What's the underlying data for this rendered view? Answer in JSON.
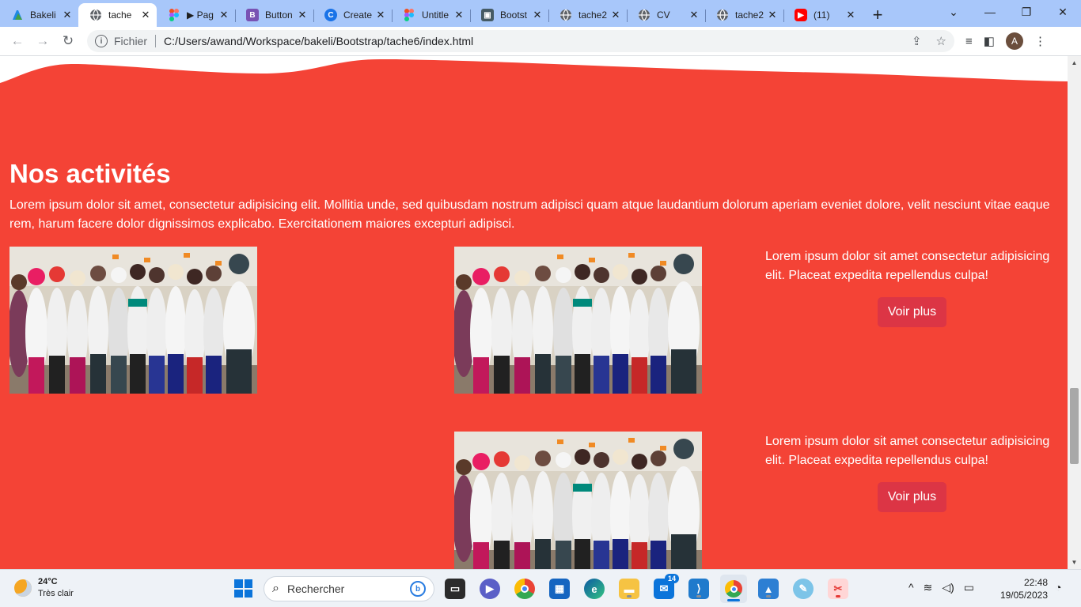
{
  "browser": {
    "tabs": [
      {
        "title": "Bakeli",
        "icon": "bakeli-icon",
        "color": "#4caf50",
        "active": false
      },
      {
        "title": "tache",
        "icon": "globe-icon",
        "color": "#5f6368",
        "active": true
      },
      {
        "title": "▶ Pag",
        "icon": "figma-icon",
        "color": "#f24e1e",
        "active": false
      },
      {
        "title": "Button",
        "icon": "bootstrap-icon",
        "color": "#7952b3",
        "active": false
      },
      {
        "title": "Create",
        "icon": "canva-icon",
        "color": "#1a73e8",
        "active": false
      },
      {
        "title": "Untitle",
        "icon": "figma-icon",
        "color": "#f24e1e",
        "active": false
      },
      {
        "title": "Bootst",
        "icon": "bootstrap-site-icon",
        "color": "#455a64",
        "active": false
      },
      {
        "title": "tache2",
        "icon": "globe-icon",
        "color": "#5f6368",
        "active": false
      },
      {
        "title": "CV",
        "icon": "globe-icon",
        "color": "#5f6368",
        "active": false
      },
      {
        "title": "tache2",
        "icon": "globe-icon",
        "color": "#5f6368",
        "active": false
      },
      {
        "title": "(11)",
        "icon": "youtube-icon",
        "color": "#ff0000",
        "active": false
      }
    ],
    "address": {
      "scheme_label": "Fichier",
      "url": "C:/Users/awand/Workspace/bakeli/Bootstrap/tache6/index.html"
    },
    "profile_initial": "A"
  },
  "page": {
    "section_title": "Nos activités",
    "intro": "Lorem ipsum dolor sit amet, consectetur adipisicing elit. Mollitia unde, sed quibusdam nostrum adipisci quam atque laudantium dolorum aperiam eveniet dolore, velit nesciunt vitae eaque rem, harum facere dolor dignissimos explicabo. Exercitationem maiores excepturi adipisci.",
    "cards": [
      {
        "text": "Lorem ipsum dolor sit amet consectetur adipisicing elit. Placeat expedita repellendus culpa!",
        "button": "Voir plus"
      },
      {
        "text": "Lorem ipsum dolor sit amet consectetur adipisicing elit. Placeat expedita repellendus culpa!",
        "button": "Voir plus"
      }
    ],
    "colors": {
      "background": "#f44336",
      "button": "#dc3545"
    }
  },
  "taskbar": {
    "weather": {
      "temp": "24°C",
      "condition": "Très clair"
    },
    "search_placeholder": "Rechercher",
    "mail_badge": "14",
    "time": "22:48",
    "date": "19/05/2023"
  }
}
